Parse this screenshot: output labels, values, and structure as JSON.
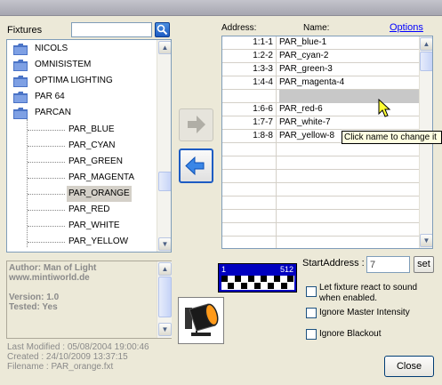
{
  "labels": {
    "fixtures": "Fixtures",
    "address": "Address:",
    "name": "Name:",
    "options": "Options",
    "start_address": "StartAddress :"
  },
  "search": {
    "value": ""
  },
  "tree": {
    "folders": [
      "NICOLS",
      "OMNISISTEM",
      "OPTIMA LIGHTING",
      "PAR 64",
      "PARCAN"
    ],
    "items": [
      "PAR_BLUE",
      "PAR_CYAN",
      "PAR_GREEN",
      "PAR_MAGENTA",
      "PAR_ORANGE",
      "PAR_RED",
      "PAR_WHITE",
      "PAR_YELLOW"
    ],
    "selected": "PAR_ORANGE"
  },
  "info": {
    "author": "Author: Man of Light",
    "url": "www.mintiworld.de",
    "version": "Version: 1.0",
    "tested": "Tested: Yes",
    "modified": "Last Modified : 05/08/2004 19:00:46",
    "created": "Created : 24/10/2009 13:37:15",
    "filename": "Filename : PAR_orange.fxt"
  },
  "grid": {
    "rows": [
      {
        "addr": "1:1-1",
        "name": "PAR_blue-1"
      },
      {
        "addr": "1:2-2",
        "name": "PAR_cyan-2"
      },
      {
        "addr": "1:3-3",
        "name": "PAR_green-3"
      },
      {
        "addr": "1:4-4",
        "name": "PAR_magenta-4"
      },
      {
        "addr": "",
        "name": ""
      },
      {
        "addr": "1:6-6",
        "name": "PAR_red-6"
      },
      {
        "addr": "1:7-7",
        "name": "PAR_white-7"
      },
      {
        "addr": "1:8-8",
        "name": "PAR_yellow-8"
      }
    ],
    "highlighted_row": 4,
    "tooltip": "Click name to change it"
  },
  "dmx": {
    "start": "1",
    "end": "512"
  },
  "start_address": {
    "value": "7",
    "set_label": "set"
  },
  "checks": [
    {
      "label": "Let fixture react to sound when enabled.",
      "checked": false
    },
    {
      "label": "Ignore Master Intensity",
      "checked": false
    },
    {
      "label": "Ignore Blackout",
      "checked": false
    }
  ],
  "buttons": {
    "close": "Close"
  },
  "icons": {
    "search": "search-icon",
    "add": "arrow-right-icon",
    "remove": "arrow-left-icon",
    "folder": "folder-icon",
    "fixture": "par-can-lamp-icon"
  },
  "colors": {
    "selection": "#d4d0c8",
    "accent": "#1d5cc3",
    "dmx": "#0000c0",
    "link": "#0000ff"
  }
}
